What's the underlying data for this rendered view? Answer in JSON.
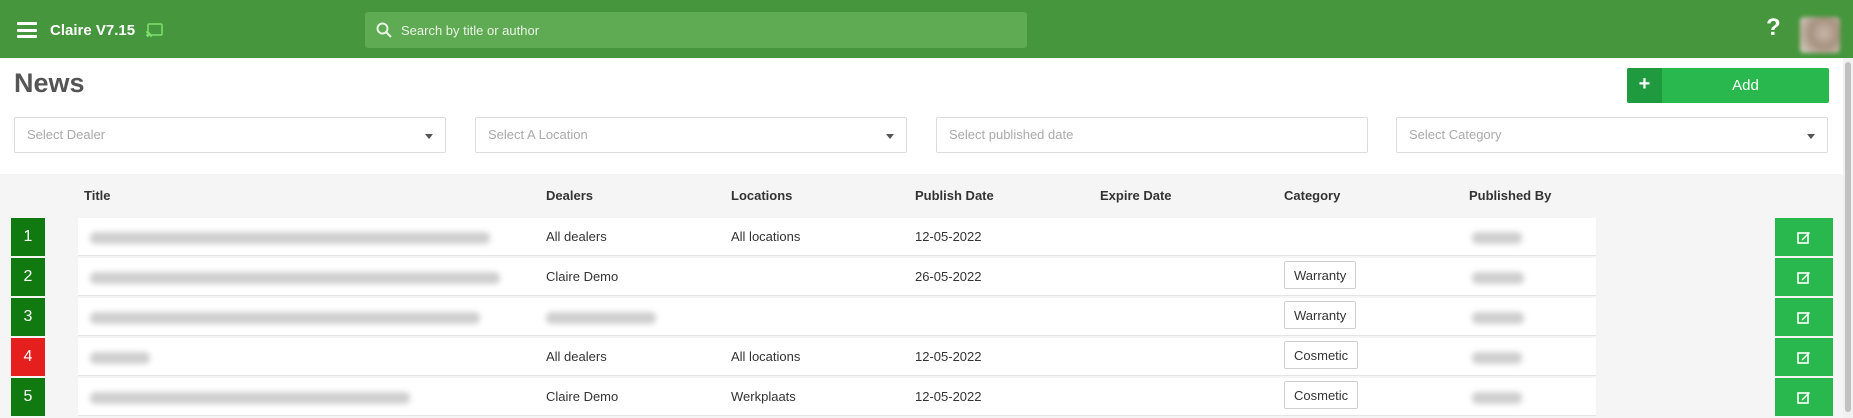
{
  "app": {
    "title": "Claire V7.15"
  },
  "search": {
    "placeholder": "Search by title or author"
  },
  "header": {
    "help": "?"
  },
  "page": {
    "title": "News",
    "add_label": "Add",
    "add_plus": "+"
  },
  "filters": {
    "dealer": "Select Dealer",
    "location": "Select A Location",
    "published_date": "Select published date",
    "category": "Select Category"
  },
  "table": {
    "columns": [
      "Title",
      "Dealers",
      "Locations",
      "Publish Date",
      "Expire Date",
      "Category",
      "Published By"
    ],
    "rows": [
      {
        "num": "1",
        "status": "green",
        "dealers": "All dealers",
        "locations": "All locations",
        "publish_date": "12-05-2022",
        "expire_date": "",
        "category": ""
      },
      {
        "num": "2",
        "status": "green",
        "dealers": "Claire Demo",
        "locations": "",
        "publish_date": "26-05-2022",
        "expire_date": "",
        "category": "Warranty"
      },
      {
        "num": "3",
        "status": "green",
        "dealers": "",
        "locations": "",
        "publish_date": "",
        "expire_date": "",
        "category": "Warranty"
      },
      {
        "num": "4",
        "status": "red",
        "dealers": "All dealers",
        "locations": "All locations",
        "publish_date": "12-05-2022",
        "expire_date": "",
        "category": "Cosmetic"
      },
      {
        "num": "5",
        "status": "green",
        "dealers": "Claire Demo",
        "locations": "Werkplaats",
        "publish_date": "12-05-2022",
        "expire_date": "",
        "category": "Cosmetic"
      }
    ]
  },
  "colors": {
    "header_bg": "#45963c",
    "accent": "#28b84d",
    "row_green": "#107a10",
    "row_red": "#e51e1e"
  },
  "icons": {
    "menu": "hamburger-icon",
    "cast": "cast-icon",
    "search": "search-icon",
    "help": "help-icon",
    "edit": "edit-icon"
  }
}
